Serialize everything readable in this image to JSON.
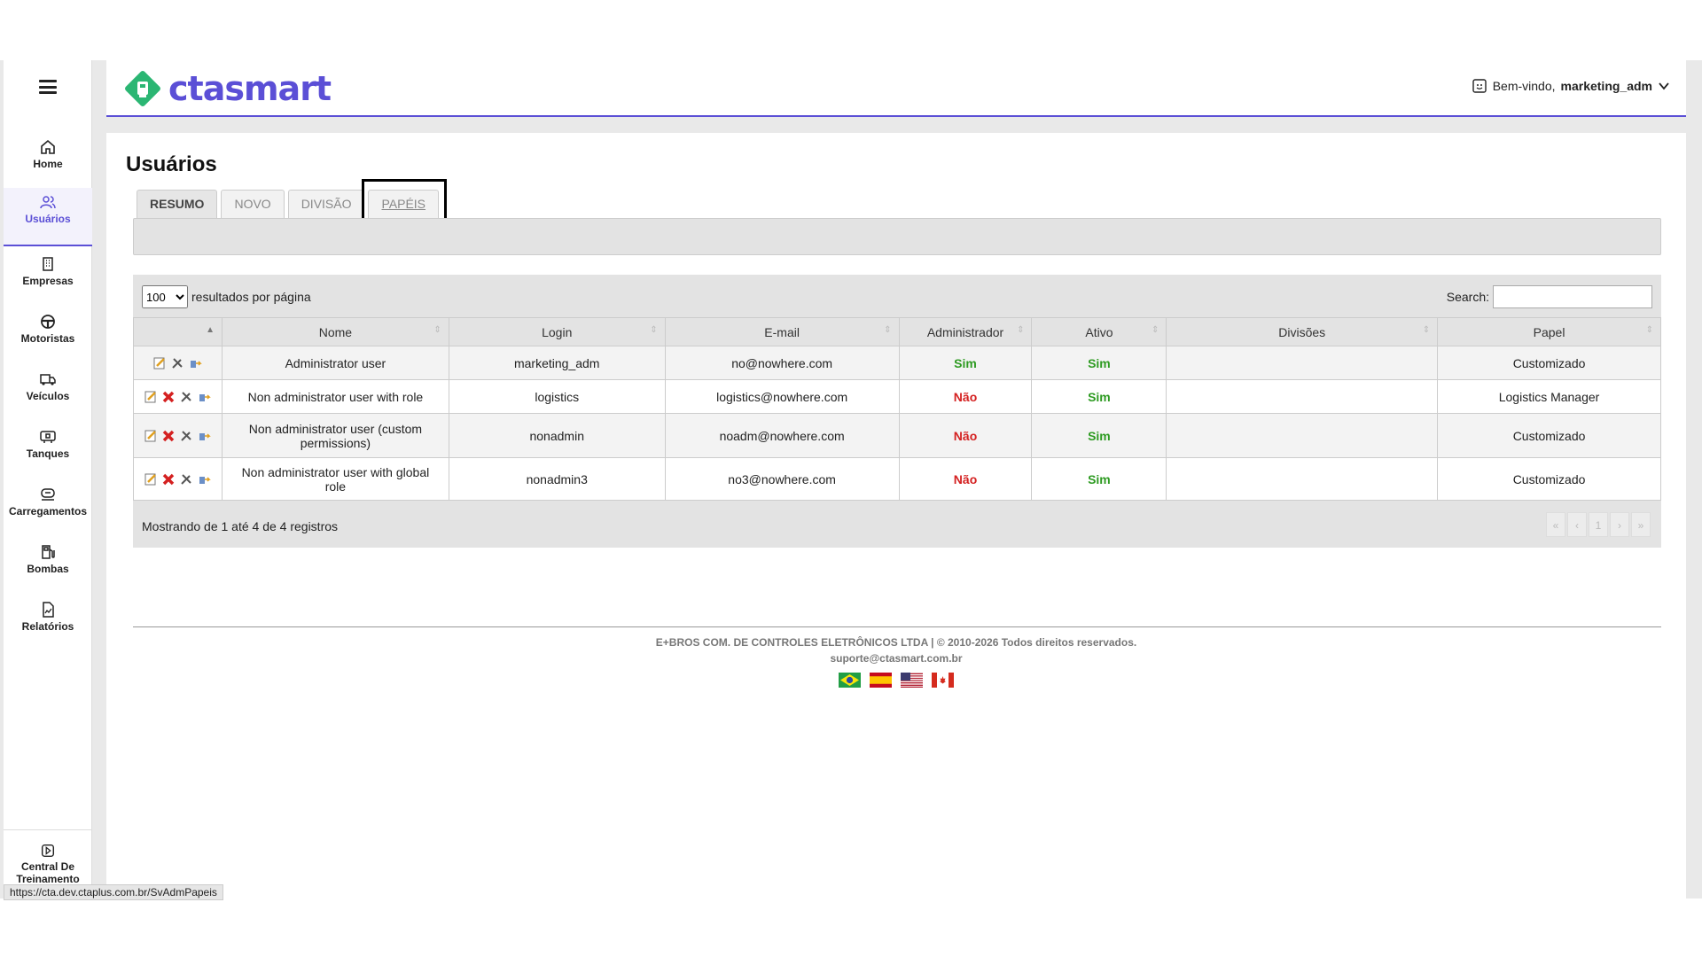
{
  "sidebar": {
    "items": [
      {
        "label": "Home",
        "icon": "home-icon"
      },
      {
        "label": "Usuários",
        "icon": "users-icon",
        "active": true
      },
      {
        "label": "Empresas",
        "icon": "building-icon"
      },
      {
        "label": "Motoristas",
        "icon": "steering-wheel-icon"
      },
      {
        "label": "Veículos",
        "icon": "truck-icon"
      },
      {
        "label": "Tanques",
        "icon": "tank-icon"
      },
      {
        "label": "Carregamentos",
        "icon": "loading-icon"
      },
      {
        "label": "Bombas",
        "icon": "fuel-pump-icon"
      },
      {
        "label": "Relatórios",
        "icon": "report-icon"
      }
    ],
    "bottom_label": "Central De Treinamento"
  },
  "header": {
    "logo_text": "ctasmart",
    "welcome_prefix": "Bem-vindo,",
    "username": "marketing_adm"
  },
  "page": {
    "title": "Usuários",
    "tabs": [
      "RESUMO",
      "NOVO",
      "DIVISÃO",
      "PAPÉIS"
    ]
  },
  "table": {
    "length_value": "100",
    "length_label": "resultados por página",
    "search_label": "Search:",
    "columns": [
      "",
      "Nome",
      "Login",
      "E-mail",
      "Administrador",
      "Ativo",
      "Divisões",
      "Papel"
    ],
    "rows": [
      {
        "nome": "Administrator user",
        "login": "marketing_adm",
        "email": "no@nowhere.com",
        "admin": "Sim",
        "ativo": "Sim",
        "divisoes": "",
        "papel": "Customizado"
      },
      {
        "nome": "Non administrator user with role",
        "login": "logistics",
        "email": "logistics@nowhere.com",
        "admin": "Não",
        "ativo": "Sim",
        "divisoes": "",
        "papel": "Logistics Manager"
      },
      {
        "nome": "Non administrator user (custom permissions)",
        "login": "nonadmin",
        "email": "noadm@nowhere.com",
        "admin": "Não",
        "ativo": "Sim",
        "divisoes": "",
        "papel": "Customizado"
      },
      {
        "nome": "Non administrator user with global role",
        "login": "nonadmin3",
        "email": "no3@nowhere.com",
        "admin": "Não",
        "ativo": "Sim",
        "divisoes": "",
        "papel": "Customizado"
      }
    ],
    "info": "Mostrando de 1 até 4 de 4 registros",
    "pager": [
      "«",
      "‹",
      "1",
      "›",
      "»"
    ]
  },
  "footer": {
    "line1": "E+BROS COM. DE CONTROLES ELETRÔNICOS LTDA | © 2010-2026 Todos direitos reservados.",
    "line2": "suporte@ctasmart.com.br"
  },
  "status_url": "https://cta.dev.ctaplus.com.br/SvAdmPapeis",
  "colors": {
    "accent": "#5b4fd6",
    "logo_green": "#2bb673",
    "yes": "#2e9b22",
    "no": "#d42020"
  }
}
